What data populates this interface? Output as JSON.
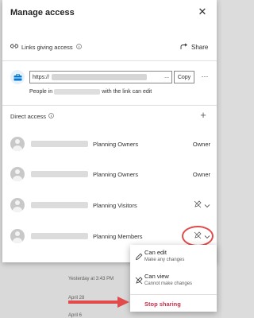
{
  "dialog": {
    "title": "Manage access",
    "close_glyph": "✕"
  },
  "links": {
    "label": "Links giving access",
    "share_label": "Share",
    "url_prefix": "https://",
    "url_ellipsis": "...",
    "copy_label": "Copy",
    "more_glyph": "···",
    "people_in_prefix": "People in",
    "people_in_suffix": "with the link can edit"
  },
  "direct_access": {
    "label": "Direct access",
    "add_glyph": "+"
  },
  "members": [
    {
      "group": "Planning Owners",
      "role": "Owner"
    },
    {
      "group": "Planning Owners",
      "role": "Owner"
    },
    {
      "group": "Planning Visitors",
      "role": ""
    },
    {
      "group": "Planning Members",
      "role": ""
    }
  ],
  "permission_menu": {
    "can_edit": {
      "title": "Can edit",
      "subtitle": "Make any changes"
    },
    "can_view": {
      "title": "Can view",
      "subtitle": "Cannot make changes"
    },
    "stop_sharing": "Stop sharing"
  },
  "background_list": {
    "items": [
      "Yesterday at 3:43 PM",
      "April 28",
      "April 6"
    ]
  },
  "colors": {
    "accent": "#0078d4",
    "highlight": "#e14b4b",
    "stop_sharing": "#c4314b"
  },
  "icons": {
    "close": "close-icon",
    "link": "link-icon",
    "share": "share-icon",
    "briefcase": "briefcase-icon",
    "info": "info-icon",
    "add": "add-icon",
    "no_edit": "no-edit-icon",
    "chevron": "chevron-down-icon",
    "pencil": "pencil-icon",
    "eye": "eye-icon",
    "arrow": "arrow-right-icon"
  }
}
